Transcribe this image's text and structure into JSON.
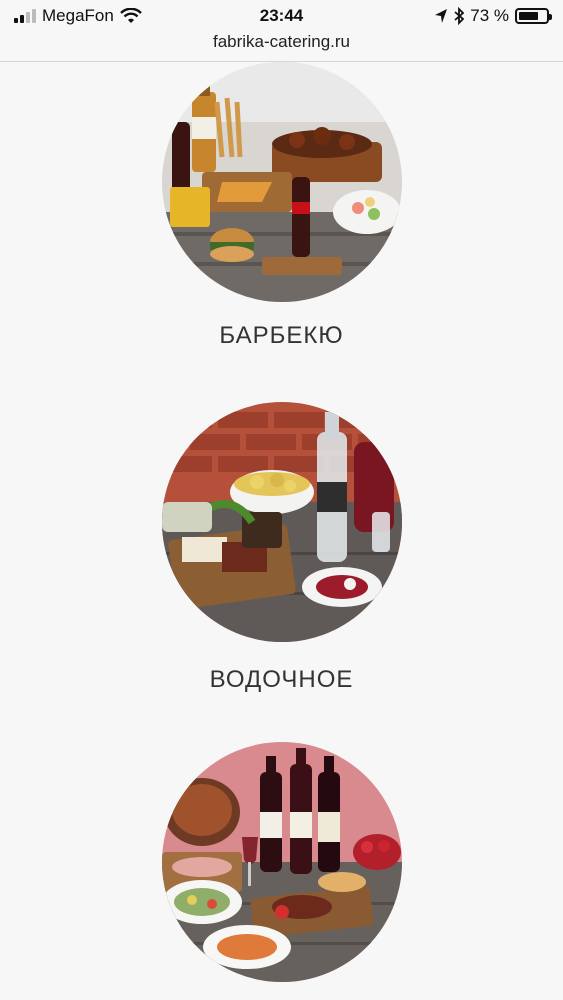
{
  "status_bar": {
    "carrier": "MegaFon",
    "time": "23:44",
    "battery_percent": "73 %",
    "battery_level": 0.73
  },
  "browser": {
    "url": "fabrika-catering.ru"
  },
  "menu": [
    {
      "title": "БАРБЕКЮ"
    },
    {
      "title": "ВОДОЧНОЕ"
    },
    {
      "title": ""
    }
  ],
  "colors": {
    "background": "#f7f7f8",
    "text": "#333333"
  }
}
